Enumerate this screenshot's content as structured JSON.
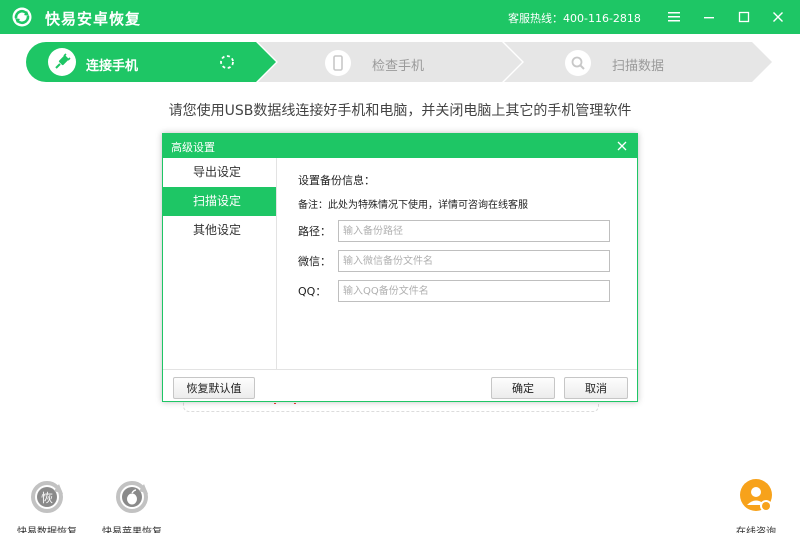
{
  "app": {
    "title": "快易安卓恢复",
    "hotline": "客服热线：400-116-2818"
  },
  "window_controls": {
    "menu": "menu-icon",
    "minimize": "minimize-icon",
    "maximize": "maximize-icon",
    "close": "close-icon"
  },
  "steps": [
    {
      "label": "连接手机",
      "icon": "usb-plug-icon",
      "active": true
    },
    {
      "label": "检查手机",
      "icon": "phone-icon",
      "active": false
    },
    {
      "label": "扫描数据",
      "icon": "magnifier-icon",
      "active": false
    }
  ],
  "instruction": "请您使用USB数据线连接好手机和电脑，并关闭电脑上其它的手机管理软件",
  "dialog": {
    "title": "高级设置",
    "sidebar": [
      {
        "label": "导出设定"
      },
      {
        "label": "扫描设定"
      },
      {
        "label": "其他设定"
      }
    ],
    "heading": "设置备份信息：",
    "note": "备注：此处为特殊情况下使用，详情可咨询在线客服",
    "fields": {
      "path": {
        "label": "路径：",
        "placeholder": "输入备份路径",
        "value": ""
      },
      "wechat": {
        "label": "微信：",
        "placeholder": "输入微信备份文件名",
        "value": ""
      },
      "qq": {
        "label": "QQ：",
        "placeholder": "输入QQ备份文件名",
        "value": ""
      }
    },
    "buttons": {
      "restore_default": "恢复默认值",
      "ok": "确定",
      "cancel": "取消"
    }
  },
  "bottom_tools": [
    {
      "label": "快易数据恢复",
      "icon": "data-recovery-icon"
    },
    {
      "label": "快易苹果恢复",
      "icon": "apple-recovery-icon"
    }
  ],
  "online_consult": {
    "label": "在线咨询",
    "icon": "chat-bubble-icon"
  },
  "colors": {
    "brand_green": "#1ec665",
    "inactive_step": "#e6e6e6",
    "orange": "#f7a21b"
  }
}
